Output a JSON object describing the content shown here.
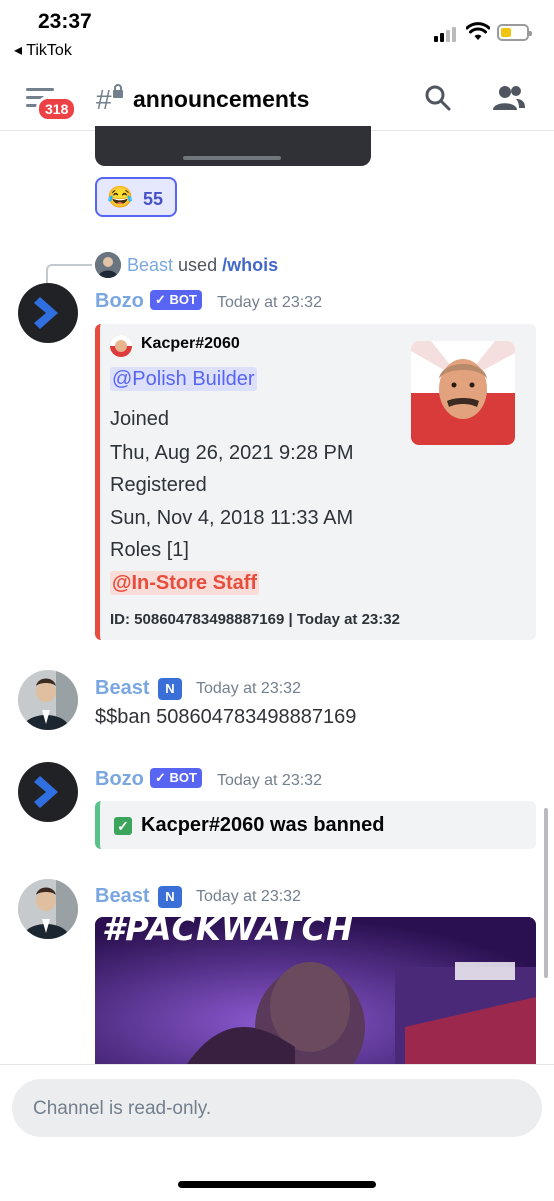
{
  "status_bar": {
    "time": "23:37",
    "back_app": "◂ TikTok"
  },
  "header": {
    "badge_count": "318",
    "hash": "#",
    "channel_name": "announcements"
  },
  "reaction": {
    "emoji": "😂",
    "count": "55"
  },
  "reply": {
    "user": "Beast",
    "verb": "used",
    "command": "/whois"
  },
  "messages": [
    {
      "author": "Bozo",
      "tag": "✓ BOT",
      "timestamp": "Today at 23:32",
      "embed": {
        "author": "Kacper#2060",
        "mention": "@Polish Builder",
        "joined_label": "Joined",
        "joined_value": "Thu, Aug 26, 2021 9:28 PM",
        "registered_label": "Registered",
        "registered_value": "Sun, Nov 4, 2018 11:33 AM",
        "roles_label": "Roles [1]",
        "role": "@In-Store Staff",
        "footer": "ID: 508604783498887169 | Today at 23:32"
      }
    },
    {
      "author": "Beast",
      "tag": "N",
      "timestamp": "Today at 23:32",
      "text": "$$ban 508604783498887169"
    },
    {
      "author": "Bozo",
      "tag": "✓ BOT",
      "timestamp": "Today at 23:32",
      "embed_text": "Kacper#2060 was banned"
    },
    {
      "author": "Beast",
      "tag": "N",
      "timestamp": "Today at 23:32",
      "gif_text": "#PACKWATCH"
    }
  ],
  "input": {
    "placeholder": "Channel is read-only."
  },
  "colors": {
    "accent": "#5865f2",
    "embed_red": "#e74c3c",
    "embed_green": "#57c38b",
    "username_blue": "#7aa7e0"
  }
}
